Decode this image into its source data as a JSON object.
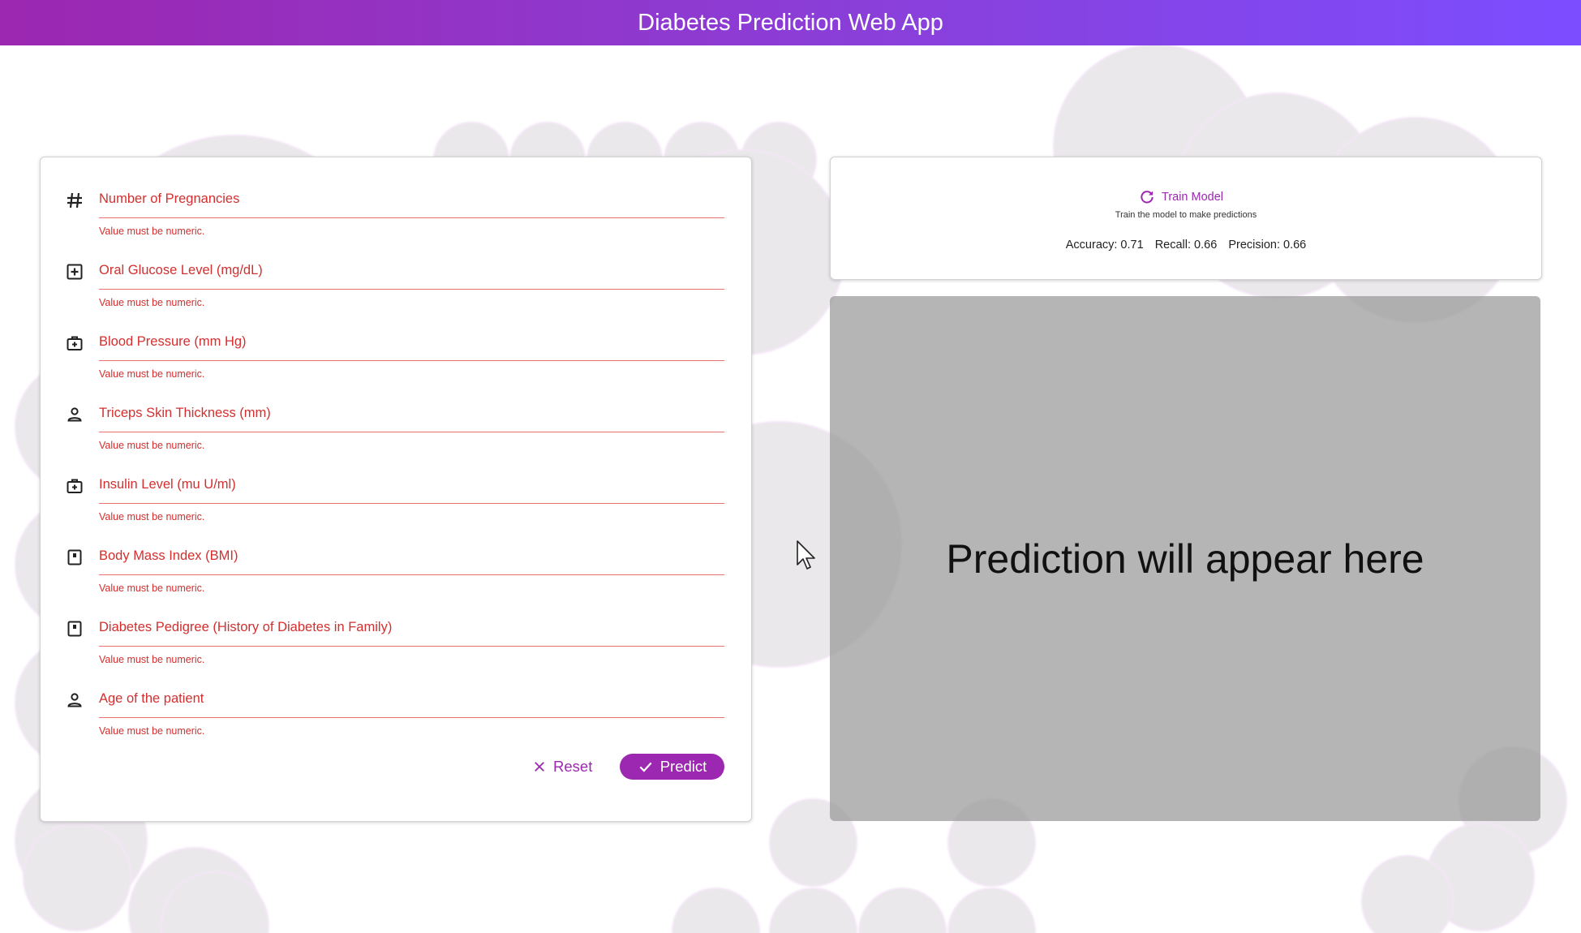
{
  "app": {
    "title": "Diabetes Prediction Web App"
  },
  "colors": {
    "primary": "#9c27b0",
    "error": "#d32f2f",
    "appbar_start": "#9c27b0",
    "appbar_end": "#7c4dff"
  },
  "form": {
    "fields": [
      {
        "icon": "hash-icon",
        "label": "Number of Pregnancies",
        "helper": "Value must be numeric."
      },
      {
        "icon": "plus-box-icon",
        "label": "Oral Glucose Level (mg/dL)",
        "helper": "Value must be numeric."
      },
      {
        "icon": "medical-bag-icon",
        "label": "Blood Pressure (mm Hg)",
        "helper": "Value must be numeric."
      },
      {
        "icon": "person-icon",
        "label": "Triceps Skin Thickness (mm)",
        "helper": "Value must be numeric."
      },
      {
        "icon": "medical-bag-icon",
        "label": "Insulin Level (mu U/ml)",
        "helper": "Value must be numeric."
      },
      {
        "icon": "scale-icon",
        "label": "Body Mass Index (BMI)",
        "helper": "Value must be numeric."
      },
      {
        "icon": "scale-icon",
        "label": "Diabetes Pedigree (History of Diabetes in Family)",
        "helper": "Value must be numeric."
      },
      {
        "icon": "person-icon",
        "label": "Age of the patient",
        "helper": "Value must be numeric."
      }
    ],
    "reset_label": "Reset",
    "predict_label": "Predict"
  },
  "training": {
    "button_label": "Train Model",
    "hint": "Train the model to make predictions",
    "accuracy": "Accuracy: 0.71",
    "recall": "Recall: 0.66",
    "precision": "Precision: 0.66"
  },
  "prediction": {
    "placeholder": "Prediction will appear here"
  }
}
